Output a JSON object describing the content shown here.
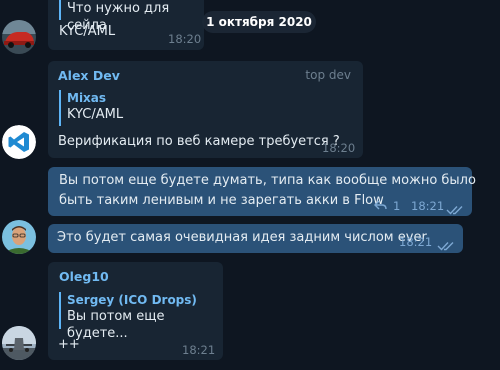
{
  "date_pill": "1 октября 2020",
  "messages": [
    {
      "quote_text": "Что нужно для сейла",
      "text": "KYC/AML",
      "time": "18:20"
    },
    {
      "sender": "Alex Dev",
      "role": "top dev",
      "quote_author": "Mixas",
      "quote_text": "KYC/AML",
      "text": "Верификация по веб камере требуется ?",
      "time": "18:20"
    },
    {
      "text_line1": "Вы потом еще будете думать, типа как вообще можно было",
      "text_line2": "быть таким ленивым и не зарегать акки в Flow",
      "replies": "1",
      "time": "18:21",
      "status": "read"
    },
    {
      "text": "Это будет самая очевидная идея задним числом ever",
      "time": "18:21",
      "status": "read"
    },
    {
      "sender": "Oleg10",
      "quote_author": "Sergey (ICO Drops)",
      "quote_text": "Вы потом еще будете...",
      "text": "++",
      "time": "18:21"
    }
  ],
  "colors": {
    "background": "#0e1621",
    "incoming_bubble": "#182533",
    "outgoing_bubble": "#2b5278",
    "accent": "#71baf2"
  },
  "icons": [
    "car-avatar",
    "vscode-avatar",
    "user-photo-avatar",
    "aircraft-avatar",
    "reply-arrow-icon",
    "double-check-icon"
  ]
}
